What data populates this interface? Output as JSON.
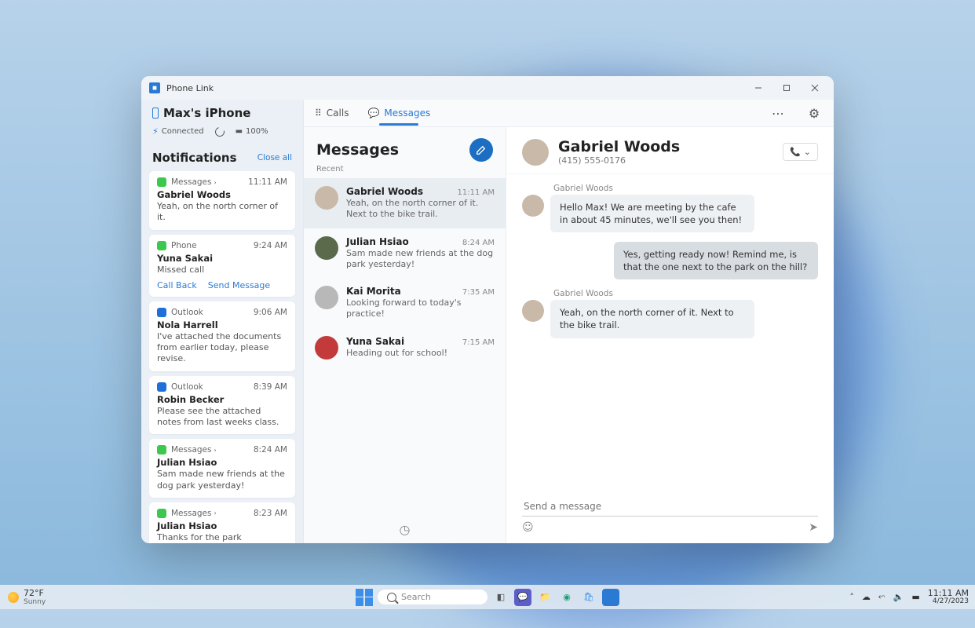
{
  "taskbar": {
    "weather_temp": "72°F",
    "weather_cond": "Sunny",
    "search_placeholder": "Search",
    "time": "11:11 AM",
    "date": "4/27/2023"
  },
  "window": {
    "title": "Phone Link"
  },
  "device": {
    "name": "Max's iPhone",
    "connection": "Connected",
    "battery": "100%"
  },
  "notifications": {
    "heading": "Notifications",
    "close_all": "Close all",
    "items": [
      {
        "app": "Messages",
        "icon": "msg",
        "time": "11:11 AM",
        "title": "Gabriel Woods",
        "body": "Yeah, on the north corner of it.",
        "chev": true
      },
      {
        "app": "Phone",
        "icon": "phone",
        "time": "9:24 AM",
        "title": "Yuna Sakai",
        "body": "Missed call",
        "actions": [
          "Call Back",
          "Send Message"
        ]
      },
      {
        "app": "Outlook",
        "icon": "outlook",
        "time": "9:06 AM",
        "title": "Nola Harrell",
        "body": "I've attached the documents from earlier today, please revise."
      },
      {
        "app": "Outlook",
        "icon": "outlook",
        "time": "8:39 AM",
        "title": "Robin Becker",
        "body": "Please see the attached notes from last weeks class."
      },
      {
        "app": "Messages",
        "icon": "msg",
        "time": "8:24 AM",
        "title": "Julian Hsiao",
        "body": "Sam made new friends at the dog park yesterday!",
        "chev": true
      },
      {
        "app": "Messages",
        "icon": "msg",
        "time": "8:23 AM",
        "title": "Julian Hsiao",
        "body": "Thanks for the park recommendation!",
        "chev": true
      }
    ]
  },
  "tabs": {
    "calls": "Calls",
    "messages": "Messages"
  },
  "messages": {
    "heading": "Messages",
    "recent_label": "Recent",
    "items": [
      {
        "name": "Gabriel Woods",
        "time": "11:11 AM",
        "preview": "Yeah, on the north corner of it. Next to the bike trail.",
        "avatar": "a1",
        "selected": true
      },
      {
        "name": "Julian Hsiao",
        "time": "8:24 AM",
        "preview": "Sam made new friends at the dog park yesterday!",
        "avatar": "a2"
      },
      {
        "name": "Kai Morita",
        "time": "7:35 AM",
        "preview": "Looking forward to today's practice!",
        "avatar": "a3"
      },
      {
        "name": "Yuna Sakai",
        "time": "7:15 AM",
        "preview": "Heading out for school!",
        "avatar": "a4"
      }
    ]
  },
  "conversation": {
    "name": "Gabriel Woods",
    "phone": "(415) 555-0176",
    "messages": [
      {
        "dir": "in",
        "sender": "Gabriel Woods",
        "text": "Hello Max! We are meeting by the cafe in about 45 minutes, we'll see you then!"
      },
      {
        "dir": "out",
        "text": "Yes, getting ready now! Remind me, is that the one next to the park on the hill?"
      },
      {
        "dir": "in",
        "sender": "Gabriel Woods",
        "text": "Yeah, on the north corner of it. Next to the bike trail."
      }
    ],
    "input_placeholder": "Send a message"
  }
}
